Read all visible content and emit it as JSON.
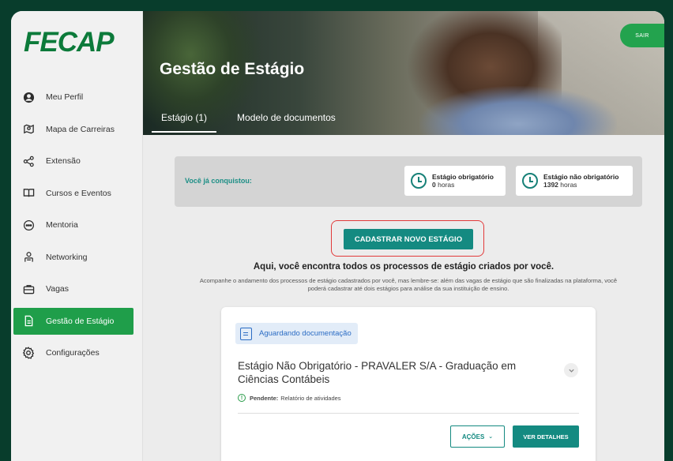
{
  "brand": {
    "logo_text": "FECAP",
    "logo_color": "#0c7a3a"
  },
  "sidebar": {
    "items": [
      {
        "label": "Meu Perfil",
        "icon": "user-circle-icon"
      },
      {
        "label": "Mapa de Carreiras",
        "icon": "map-pin-icon"
      },
      {
        "label": "Extensão",
        "icon": "share-icon"
      },
      {
        "label": "Cursos e Eventos",
        "icon": "book-open-icon"
      },
      {
        "label": "Mentoria",
        "icon": "chat-bubble-icon"
      },
      {
        "label": "Networking",
        "icon": "people-icon"
      },
      {
        "label": "Vagas",
        "icon": "briefcase-icon"
      },
      {
        "label": "Gestão de Estágio",
        "icon": "document-icon",
        "active": true
      },
      {
        "label": "Configurações",
        "icon": "gear-icon"
      }
    ]
  },
  "header": {
    "title": "Gestão de Estágio",
    "logout_label": "SAIR",
    "tabs": [
      {
        "label": "Estágio (1)",
        "active": true
      },
      {
        "label": "Modelo de documentos",
        "active": false
      }
    ]
  },
  "achievements": {
    "label": "Você já conquistou:",
    "stats": [
      {
        "title": "Estágio obrigatório",
        "value": "0",
        "unit": "horas",
        "icon": "clock-icon"
      },
      {
        "title": "Estágio não obrigatório",
        "value": "1392",
        "unit": "horas",
        "icon": "clock-icon"
      }
    ]
  },
  "cta": {
    "button_label": "CADASTRAR NOVO ESTÁGIO",
    "headline": "Aqui, você encontra todos os processos de estágio criados por você.",
    "subtext": "Acompanhe o andamento dos processos de estágio cadastrados por você, mas lembre-se: além das vagas de estágio que são finalizadas na plataforma, você poderá cadastrar até dois estágios para análise da sua instituição de ensino."
  },
  "card": {
    "status_badge": "Aguardando documentação",
    "title": "Estágio Não Obrigatório - PRAVALER S/A - Graduação em Ciências Contábeis",
    "pending_label": "Pendente:",
    "pending_text": "Relatório de atividades",
    "actions_label": "AÇÕES",
    "details_label": "VER DETALHES"
  },
  "colors": {
    "accent_green": "#1f9e4a",
    "teal": "#148a81",
    "highlight_border": "#e23a3a",
    "background": "#083d2c"
  }
}
